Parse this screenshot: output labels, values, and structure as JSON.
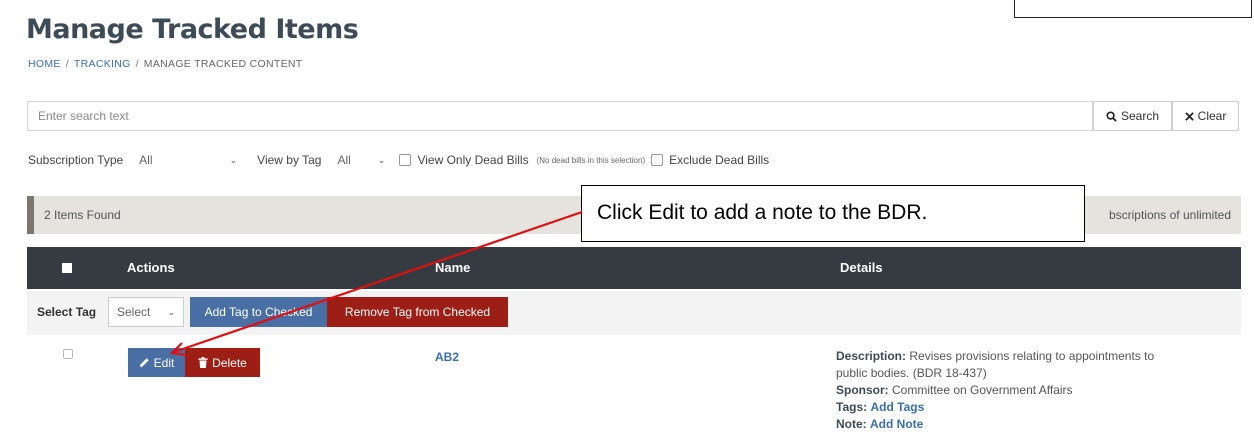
{
  "page": {
    "title": "Manage Tracked Items"
  },
  "breadcrumb": {
    "home": "HOME",
    "tracking": "TRACKING",
    "current": "MANAGE TRACKED CONTENT",
    "separator": "/"
  },
  "search": {
    "placeholder": "Enter search text",
    "value": "",
    "search_label": "Search",
    "clear_label": "Clear"
  },
  "filters": {
    "subscription_type_label": "Subscription Type",
    "subscription_type_value": "All",
    "view_by_tag_label": "View by Tag",
    "view_by_tag_value": "All",
    "view_only_dead_label": "View Only Dead Bills",
    "dead_note": "(No dead bills in this selection)",
    "exclude_dead_label": "Exclude Dead Bills"
  },
  "results": {
    "found_text": "2 Items Found",
    "subscription_text": "bscriptions of unlimited"
  },
  "table": {
    "headers": {
      "actions": "Actions",
      "name": "Name",
      "details": "Details"
    },
    "tag_row": {
      "label": "Select Tag",
      "select_value": "Select",
      "add_button": "Add Tag to Checked",
      "remove_button": "Remove Tag from Checked"
    },
    "rows": [
      {
        "edit_label": "Edit",
        "delete_label": "Delete",
        "name": "AB2",
        "description_label": "Description:",
        "description_line1": "Revises provisions relating to appointments to",
        "description_line2": "public bodies. (BDR 18-437)",
        "sponsor_label": "Sponsor:",
        "sponsor": "Committee on Government Affairs",
        "tags_label": "Tags:",
        "tags_link": "Add Tags",
        "note_label": "Note:",
        "note_link": "Add Note"
      }
    ]
  },
  "callout": {
    "text": "Click Edit to add a note to the BDR."
  },
  "colors": {
    "primary_blue": "#4a6fa5",
    "danger_red": "#9c1e14",
    "header_dark": "#363b41",
    "link_blue": "#3a6fad",
    "annotation_arrow": "#e01010"
  },
  "icons": {
    "search": "search-icon",
    "clear": "close-icon",
    "edit": "pencil-icon",
    "delete": "trash-icon",
    "chevron": "chevron-down-icon"
  }
}
